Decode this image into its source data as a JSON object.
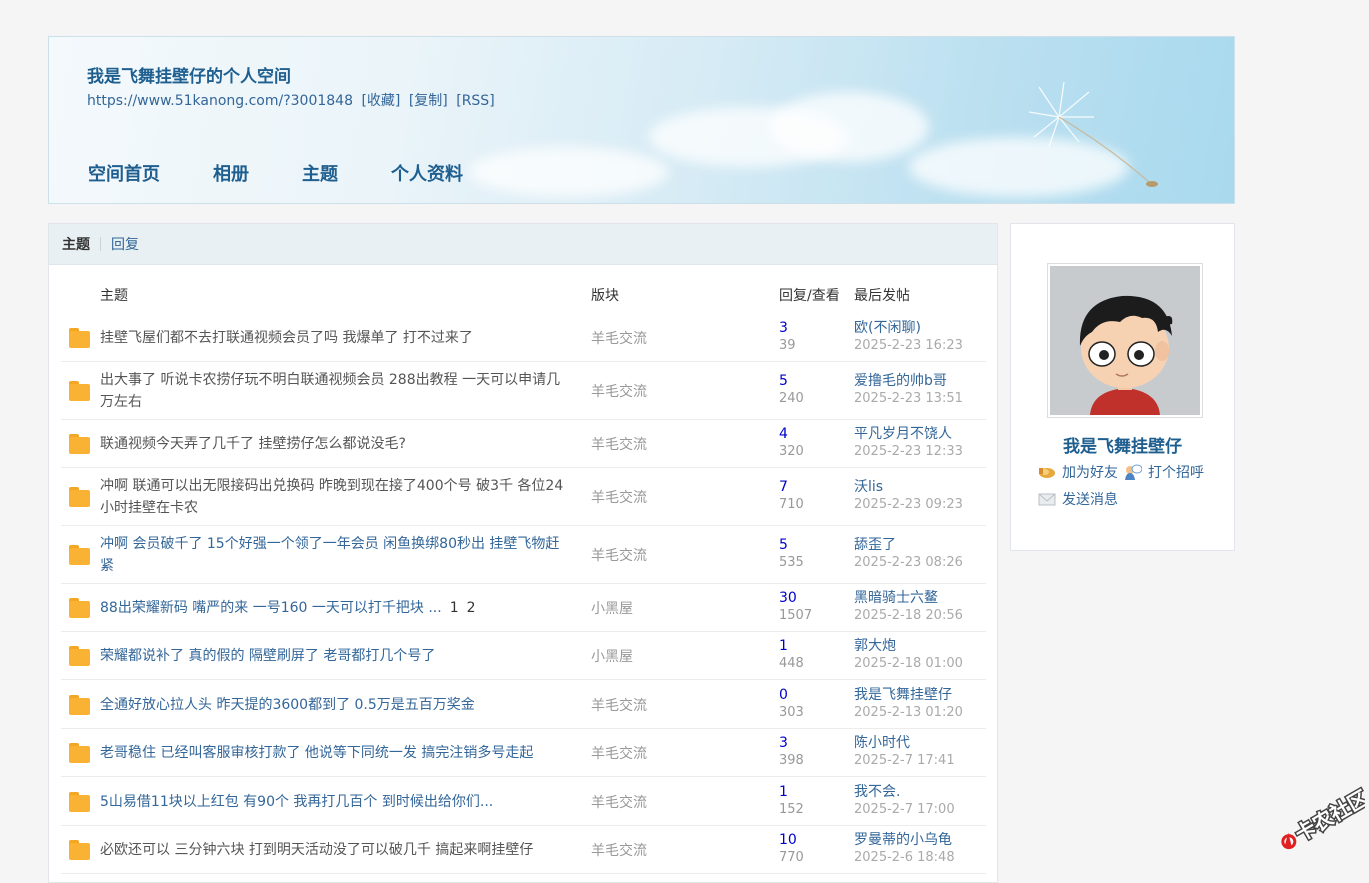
{
  "header": {
    "title": "我是飞舞挂壁仔的个人空间",
    "url": "https://www.51kanong.com/?3001848",
    "links": [
      "[收藏]",
      "[复制]",
      "[RSS]"
    ],
    "nav": [
      "空间首页",
      "相册",
      "主题",
      "个人资料"
    ]
  },
  "tabs": {
    "active": "主题",
    "other": "回复"
  },
  "columns": {
    "subject": "主题",
    "forum": "版块",
    "stats": "回复/查看",
    "last": "最后发帖"
  },
  "threads": [
    {
      "subject": "挂壁飞屋们都不去打联通视频会员了吗 我爆单了 打不过来了",
      "forum": "羊毛交流",
      "replies": "3",
      "views": "39",
      "last_user": "欧(不闲聊)",
      "last_time": "2025-2-23 16:23"
    },
    {
      "subject": "出大事了 听说卡农捞仔玩不明白联通视频会员 288出教程 一天可以申请几万左右",
      "forum": "羊毛交流",
      "replies": "5",
      "views": "240",
      "last_user": "爱撸毛的帅b哥",
      "last_time": "2025-2-23 13:51"
    },
    {
      "subject": "联通视频今天弄了几千了 挂壁捞仔怎么都说没毛?",
      "forum": "羊毛交流",
      "replies": "4",
      "views": "320",
      "last_user": "平凡岁月不饶人",
      "last_time": "2025-2-23 12:33"
    },
    {
      "subject": "冲啊 联通可以出无限接码出兑换码 昨晚到现在接了400个号 破3千 各位24小时挂壁在卡农",
      "forum": "羊毛交流",
      "replies": "7",
      "views": "710",
      "last_user": "沃lis",
      "last_time": "2025-2-23 09:23"
    },
    {
      "subject": "冲啊 会员破千了 15个好强一个领了一年会员 闲鱼换绑80秒出 挂壁飞物赶紧",
      "forum": "羊毛交流",
      "replies": "5",
      "views": "535",
      "last_user": "舔歪了",
      "last_time": "2025-2-23 08:26"
    },
    {
      "subject": "88出荣耀新码 嘴严的来 一号160 一天可以打千把块 ...",
      "pages": [
        "1",
        "2"
      ],
      "forum": "小黑屋",
      "replies": "30",
      "views": "1507",
      "last_user": "黑暗骑士六鳌",
      "last_time": "2025-2-18 20:56"
    },
    {
      "subject": "荣耀都说补了 真的假的 隔壁刷屏了 老哥都打几个号了",
      "forum": "小黑屋",
      "replies": "1",
      "views": "448",
      "last_user": "郭大炮",
      "last_time": "2025-2-18 01:00"
    },
    {
      "subject": "全通好放心拉人头 昨天提的3600都到了 0.5万是五百万奖金",
      "forum": "羊毛交流",
      "replies": "0",
      "views": "303",
      "last_user": "我是飞舞挂壁仔",
      "last_time": "2025-2-13 01:20"
    },
    {
      "subject": "老哥稳住 已经叫客服审核打款了 他说等下同统一发 搞完注销多号走起",
      "forum": "羊毛交流",
      "replies": "3",
      "views": "398",
      "last_user": "陈小时代",
      "last_time": "2025-2-7 17:41"
    },
    {
      "subject": "5山易借11块以上红包 有90个 我再打几百个 到时候出给你们...",
      "forum": "羊毛交流",
      "replies": "1",
      "views": "152",
      "last_user": "我不会.",
      "last_time": "2025-2-7 17:00"
    },
    {
      "subject": "必欧还可以 三分钟六块 打到明天活动没了可以破几千 搞起来啊挂壁仔",
      "forum": "羊毛交流",
      "replies": "10",
      "views": "770",
      "last_user": "罗曼蒂的小乌龟",
      "last_time": "2025-2-6 18:48"
    }
  ],
  "profile": {
    "name": "我是飞舞挂壁仔",
    "add_friend": "加为好友",
    "greet": "打个招呼",
    "message": "发送消息"
  },
  "watermark": "卡农社区"
}
